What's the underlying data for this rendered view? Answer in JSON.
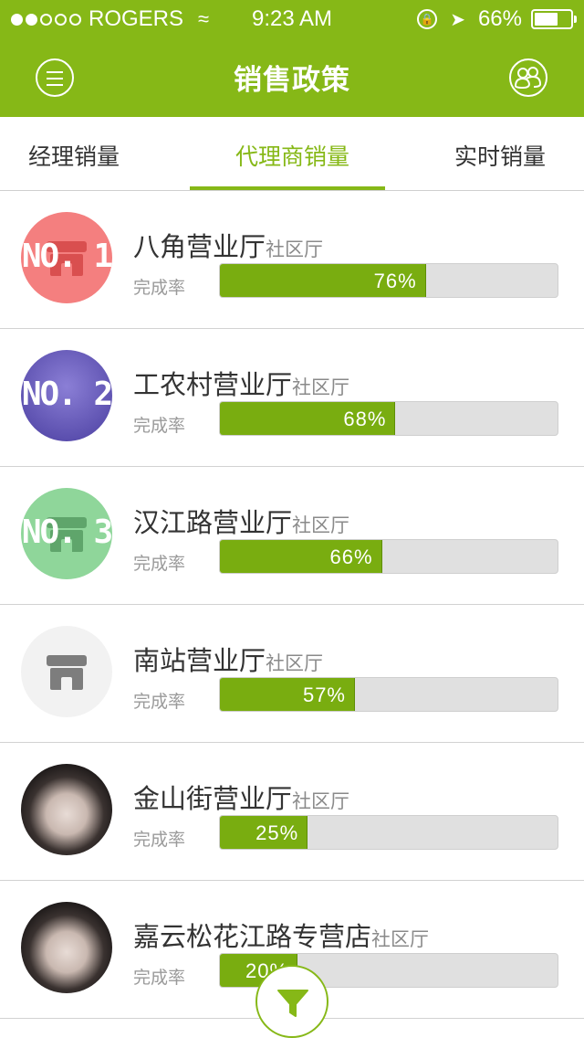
{
  "status_bar": {
    "signal_dots": [
      true,
      true,
      false,
      false,
      false
    ],
    "carrier": "ROGERS",
    "wifi_icon": "wifi-icon",
    "time": "9:23 AM",
    "battery_percent": "66%",
    "battery_level": 0.66
  },
  "header": {
    "title": "销售政策",
    "menu_icon": "menu-icon",
    "people_icon": "people-icon",
    "color": "#86b817"
  },
  "tabs": [
    {
      "label": "经理销量",
      "active": false
    },
    {
      "label": "代理商销量",
      "active": true
    },
    {
      "label": "实时销量",
      "active": false
    }
  ],
  "rate_label": "完成率",
  "stores": [
    {
      "name": "八角营业厅",
      "type": "社区厅",
      "rank": "NO. 1",
      "rate": 0.76,
      "rate_text": "76%",
      "avatar": "store-icon"
    },
    {
      "name": "工农村营业厅",
      "type": "社区厅",
      "rank": "NO. 2",
      "rate": 0.68,
      "rate_text": "68%",
      "avatar": "photo"
    },
    {
      "name": "汉江路营业厅",
      "type": "社区厅",
      "rank": "NO. 3",
      "rate": 0.66,
      "rate_text": "66%",
      "avatar": "store-icon"
    },
    {
      "name": "南站营业厅",
      "type": "社区厅",
      "rank": "",
      "rate": 0.57,
      "rate_text": "57%",
      "avatar": "store-icon"
    },
    {
      "name": "金山街营业厅",
      "type": "社区厅",
      "rank": "",
      "rate": 0.25,
      "rate_text": "25%",
      "avatar": "photo"
    },
    {
      "name": "嘉云松花江路专营店",
      "type": "社区厅",
      "rank": "",
      "rate": 0.2,
      "rate_text": "20%",
      "avatar": "photo"
    }
  ],
  "filter_button": {
    "icon": "filter-icon"
  },
  "colors": {
    "accent": "#86b817",
    "bar_fill": "#79ad10",
    "bar_track": "#e0e0e0"
  }
}
